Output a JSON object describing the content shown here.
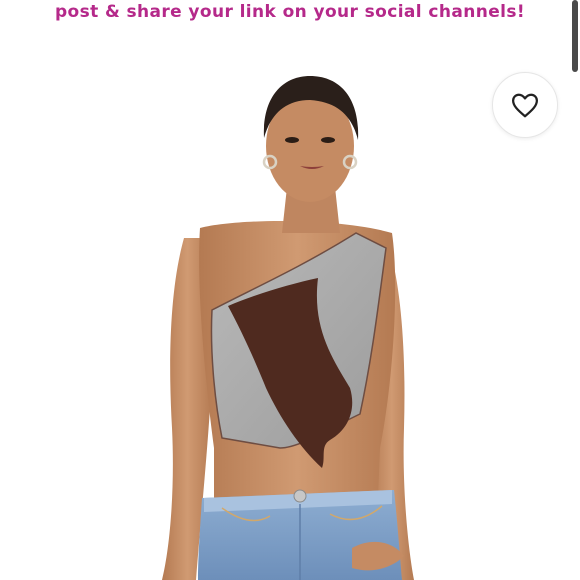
{
  "banner": {
    "text": "post & share your link on your social channels!",
    "color": "#b5298a"
  },
  "product": {
    "image_description_icon": "model-wearing-top-image"
  },
  "favorite": {
    "icon": "heart-icon"
  },
  "colors": {
    "background": "#ffffff",
    "grey_fabric": "#a7a7a7",
    "brown_fabric": "#4f2a1f",
    "denim": "#7f9fc4",
    "skin": "#c98f66"
  }
}
